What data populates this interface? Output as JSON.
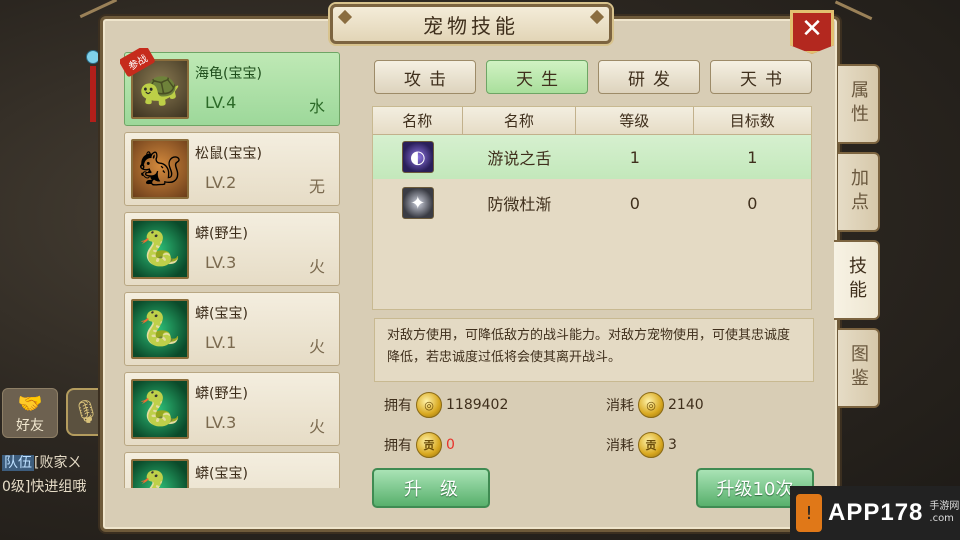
{
  "panel": {
    "title": "宠物技能",
    "close_label": "✕"
  },
  "pets": [
    {
      "name": "海龟(宝宝)",
      "level": "LV.4",
      "element": "水",
      "avatar": "turtle",
      "selected": true,
      "badge": "参战"
    },
    {
      "name": "松鼠(宝宝)",
      "level": "LV.2",
      "element": "无",
      "avatar": "squirrel",
      "selected": false
    },
    {
      "name": "蟒(野生)",
      "level": "LV.3",
      "element": "火",
      "avatar": "snake",
      "selected": false
    },
    {
      "name": "蟒(宝宝)",
      "level": "LV.1",
      "element": "火",
      "avatar": "snake",
      "selected": false
    },
    {
      "name": "蟒(野生)",
      "level": "LV.3",
      "element": "火",
      "avatar": "snake",
      "selected": false
    },
    {
      "name": "蟒(宝宝)",
      "level": "",
      "element": "",
      "avatar": "snake",
      "selected": false
    }
  ],
  "skill_tabs": [
    {
      "label": "攻击",
      "active": false
    },
    {
      "label": "天生",
      "active": true
    },
    {
      "label": "研发",
      "active": false
    },
    {
      "label": "天书",
      "active": false
    }
  ],
  "table": {
    "headers": [
      "名称",
      "名称",
      "等级",
      "目标数"
    ],
    "rows": [
      {
        "icon": "tongue-icon",
        "name": "游说之舌",
        "level": "1",
        "targets": "1",
        "selected": true
      },
      {
        "icon": "prevent-icon",
        "name": "防微杜渐",
        "level": "0",
        "targets": "0",
        "selected": false
      }
    ]
  },
  "description": "对敌方使用，可降低敌方的战斗能力。对敌方宠物使用，可使其忠诚度降低，若忠诚度过低将会使其离开战斗。",
  "costs": {
    "own_label": "拥有",
    "cost_label": "消耗",
    "own_gold": "1189402",
    "cost_gold": "2140",
    "own_tribute": "0",
    "cost_tribute": "3",
    "tribute_glyph": "贡"
  },
  "buttons": {
    "upgrade": "升　级",
    "upgrade10": "升级10次"
  },
  "side_tabs": [
    {
      "label": "属性",
      "active": false
    },
    {
      "label": "加点",
      "active": false
    },
    {
      "label": "技能",
      "active": true
    },
    {
      "label": "图鉴",
      "active": false
    }
  ],
  "left_ui": {
    "friend_label": "好友",
    "chat_tag": "队伍",
    "chat_line1": "[败家ㄨ",
    "chat_line2": "0级]快进组哦"
  },
  "watermark": {
    "brand": "APP178",
    "sub1": "手游网",
    "sub2": ".com"
  },
  "colors": {
    "selected_green": "#a9df9c",
    "frame_brown": "#7c6440",
    "close_red": "#b3281f",
    "value_red": "#e8322a"
  }
}
